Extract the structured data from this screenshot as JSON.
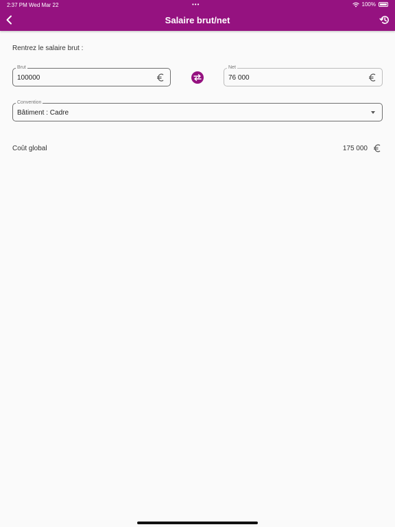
{
  "status_bar": {
    "time": "2:37 PM",
    "date": "Wed Mar 22",
    "dots": "•••",
    "battery": "100%"
  },
  "header": {
    "title": "Salaire brut/net",
    "back_icon": "chevron-left-icon",
    "history_icon": "history-icon"
  },
  "form": {
    "instruction": "Rentrez le salaire brut :",
    "brut": {
      "label": "Brut",
      "value": "100000"
    },
    "net": {
      "label": "Net",
      "value": "76 000"
    },
    "convention": {
      "label": "Convention",
      "value": "Bâtiment : Cadre"
    },
    "currency_icon": "euro-icon",
    "swap_icon": "swap-icon"
  },
  "result": {
    "label": "Coût global",
    "value": "175 000"
  },
  "colors": {
    "brand": "#951280",
    "background": "#fafafa"
  }
}
